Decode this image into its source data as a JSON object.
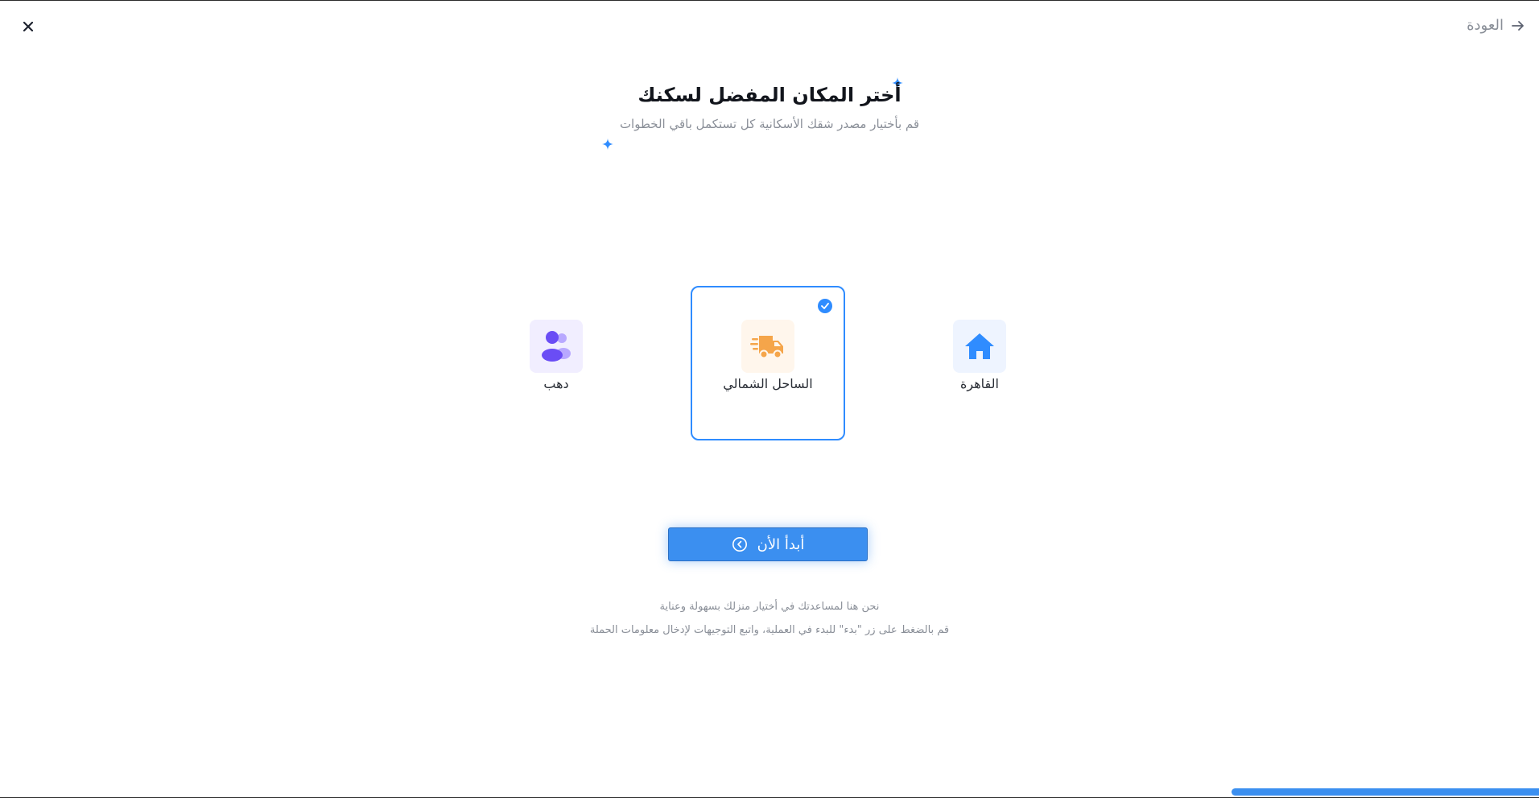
{
  "nav": {
    "back_label": "العودة",
    "close_icon": "close-icon",
    "back_icon": "arrow-right-icon"
  },
  "header": {
    "title": "أختر المكان المفضل لسكنك",
    "subtitle": "قم بأختيار مصدر شقك الأسكانية كل تستكمل باقي الخطوات"
  },
  "options": [
    {
      "label": "القاهرة",
      "icon": "home-icon",
      "selected": false,
      "tile_color": "#eef4ff",
      "icon_color": "#2f8cff"
    },
    {
      "label": "الساحل الشمالي",
      "icon": "delivery-truck-icon",
      "selected": true,
      "tile_color": "#fff6ec",
      "icon_color": "#f5a54a"
    },
    {
      "label": "دهب",
      "icon": "users-icon",
      "selected": false,
      "tile_color": "#f1eeff",
      "icon_color": "#6a4df5"
    }
  ],
  "start_button": {
    "label": "أبدأ الأن",
    "icon": "chevron-circle-icon"
  },
  "footer": {
    "line1": "نحن هنا لمساعدتك في أختيار منزلك بسهولة وعناية",
    "line2": "قم بالضغط على زر \"بدء\" للبدء في العملية، واتبع التوجيهات لإدخال معلومات الحملة"
  },
  "progress": {
    "fraction": 0.2
  },
  "colors": {
    "accent": "#3b8ff0",
    "sparkle": "#2f8cff"
  }
}
